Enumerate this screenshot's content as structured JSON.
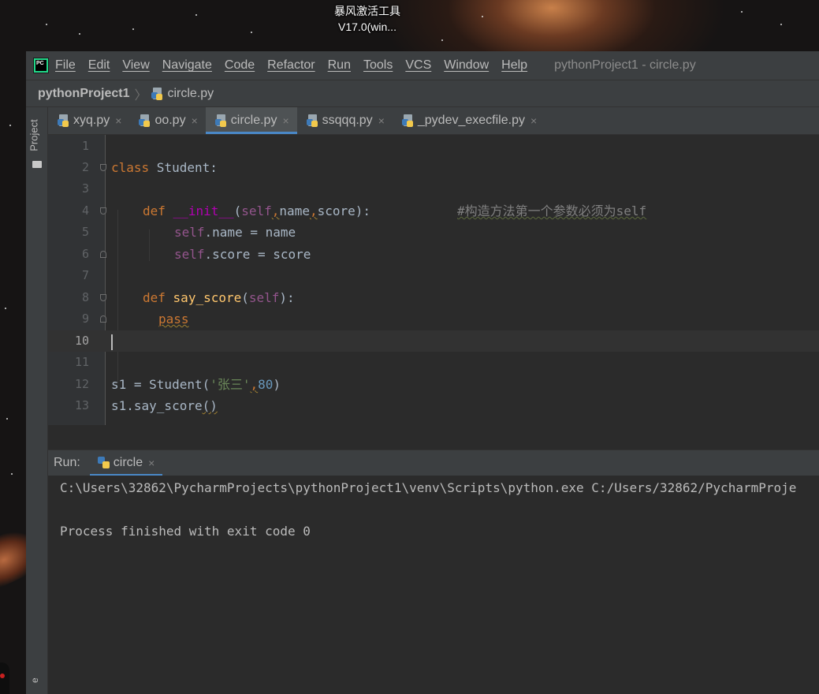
{
  "desktop": {
    "icon_label_line1": "暴风激活工具",
    "icon_label_line2": "V17.0(win..."
  },
  "menubar": {
    "logo_text": "PC",
    "items": [
      "File",
      "Edit",
      "View",
      "Navigate",
      "Code",
      "Refactor",
      "Run",
      "Tools",
      "VCS",
      "Window",
      "Help"
    ],
    "window_title": "pythonProject1 - circle.py"
  },
  "breadcrumb": {
    "project": "pythonProject1",
    "separator": "〉",
    "file": "circle.py"
  },
  "left_strip": {
    "project_label": "Project",
    "bottom_label": "e"
  },
  "tabs": [
    {
      "label": "xyq.py",
      "active": false
    },
    {
      "label": "oo.py",
      "active": false
    },
    {
      "label": "circle.py",
      "active": true
    },
    {
      "label": "ssqqq.py",
      "active": false
    },
    {
      "label": "_pydev_execfile.py",
      "active": false
    }
  ],
  "tab_close_glyph": "×",
  "editor": {
    "line_numbers": [
      "1",
      "2",
      "3",
      "4",
      "5",
      "6",
      "7",
      "8",
      "9",
      "10",
      "11",
      "12",
      "13"
    ],
    "current_line": "10",
    "code": {
      "l2_kw": "class",
      "l2_rest": " Student:",
      "l4_def": "def",
      "l4_name": "__init__",
      "l4_open": "(",
      "l4_self": "self",
      "l4_c1": ",",
      "l4_name_param": "name",
      "l4_c2": ",",
      "l4_score_param": "score",
      "l4_close": "):",
      "l4_comment": "#构造方法第一个参数必须为self",
      "l5_self": "self",
      "l5_rest": ".name = name",
      "l6_self": "self",
      "l6_rest": ".score = score",
      "l8_def": "def",
      "l8_name": "say_score",
      "l8_open": "(",
      "l8_self": "self",
      "l8_close": "):",
      "l9_pass": "pass",
      "l12_a": "s1 = Student(",
      "l12_str": "'张三'",
      "l12_comma": ",",
      "l12_num": "80",
      "l12_close": ")",
      "l13_a": "s1.say_score",
      "l13_paren": "()"
    }
  },
  "run_panel": {
    "label": "Run:",
    "tab_label": "circle",
    "output_line1": "C:\\Users\\32862\\PycharmProjects\\pythonProject1\\venv\\Scripts\\python.exe C:/Users/32862/PycharmProje",
    "output_line2": "Process finished with exit code 0"
  },
  "colors": {
    "accent": "#4a88c7",
    "keyword": "#cc7832",
    "function": "#ffc66d",
    "self": "#94558d",
    "string": "#6a8759",
    "number": "#6897bb",
    "comment": "#808080"
  }
}
